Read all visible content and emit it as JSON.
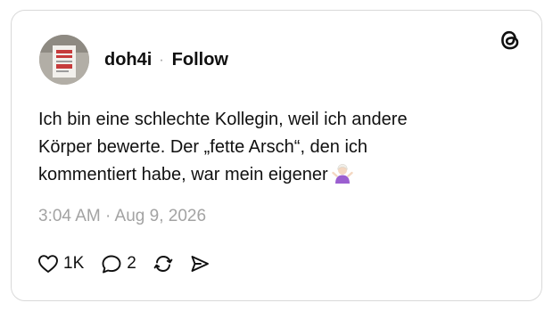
{
  "post": {
    "username": "doh4i",
    "separator": "·",
    "follow_label": "Follow",
    "body_lines": [
      "Ich bin eine schlechte Kollegin, weil ich andere",
      "Körper bewerte. Der „fette Arsch“, den ich",
      "kommentiert habe, war mein eigener"
    ],
    "emoji_icon": "person-shrugging-emoji",
    "timestamp": "3:04 AM · Aug 9, 2026",
    "likes": "1K",
    "replies": "2"
  },
  "brand": {
    "logo": "threads-logo-icon"
  },
  "colors": {
    "text": "#101010",
    "muted": "#a3a3a3",
    "border": "#d9d9d9"
  }
}
